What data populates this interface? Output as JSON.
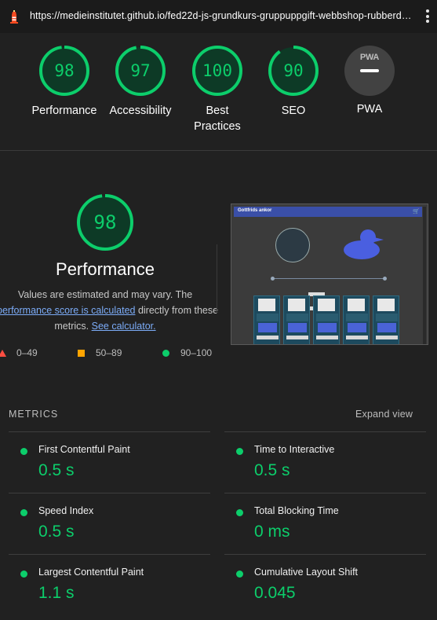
{
  "browser": {
    "url": "https://medieinstitutet.github.io/fed22d-js-grundkurs-gruppuppgift-webbshop-rubberduckg..."
  },
  "colors": {
    "pass": "#0cce6b",
    "average": "#ffa400",
    "fail": "#ff4e42",
    "link": "#7cacf8",
    "background": "#212121"
  },
  "summary_gauges": [
    {
      "label": "Performance",
      "score": "98"
    },
    {
      "label": "Accessibility",
      "score": "97"
    },
    {
      "label": "Best Practices",
      "score": "100"
    },
    {
      "label": "SEO",
      "score": "90"
    },
    {
      "label": "PWA",
      "badge": "PWA",
      "icon": "pwa-badge-icon"
    }
  ],
  "performance": {
    "score": "98",
    "title": "Performance",
    "desc_1": "Values are estimated and may vary. The",
    "desc_link": "performance score is calculated",
    "desc_2": " directly from these",
    "desc_3": "metrics.",
    "calculator_link": "See calculator.",
    "legend": [
      {
        "range": "0–49",
        "shape": "triangle",
        "color": "#ff4e42"
      },
      {
        "range": "50–89",
        "shape": "square",
        "color": "#ffa400"
      },
      {
        "range": "90–100",
        "shape": "circle",
        "color": "#0cce6b"
      }
    ],
    "screenshot_title": "Gottfrids ankor"
  },
  "metrics": {
    "heading": "METRICS",
    "expand_label": "Expand view",
    "items": [
      {
        "name": "First Contentful Paint",
        "value": "0.5 s"
      },
      {
        "name": "Time to Interactive",
        "value": "0.5 s"
      },
      {
        "name": "Speed Index",
        "value": "0.5 s"
      },
      {
        "name": "Total Blocking Time",
        "value": "0 ms"
      },
      {
        "name": "Largest Contentful Paint",
        "value": "1.1 s"
      },
      {
        "name": "Cumulative Layout Shift",
        "value": "0.045"
      }
    ]
  }
}
